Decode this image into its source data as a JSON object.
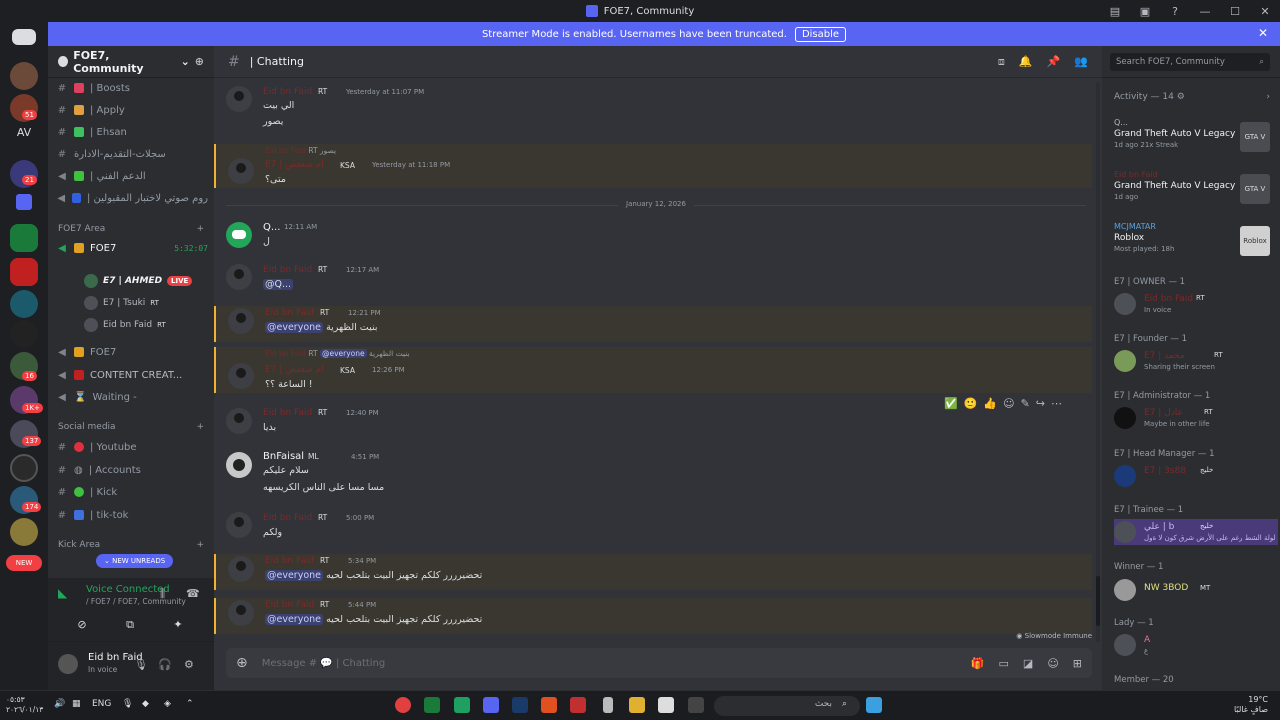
{
  "window": {
    "title": "FOE7, Community"
  },
  "banner": {
    "text": "Streamer Mode is enabled. Usernames have been truncated.",
    "button": "Disable"
  },
  "rail": {
    "av_label": "AV",
    "badges": [
      "51",
      "21",
      "16",
      "1K+",
      "137",
      "174"
    ],
    "new_label": "NEW"
  },
  "sidebar": {
    "guild_name": "FOE7, Community",
    "channels": [
      {
        "label": "| Boosts"
      },
      {
        "label": "| Apply"
      },
      {
        "label": "| Ehsan"
      },
      {
        "label": "سجلات-التقديم-الادارة"
      },
      {
        "label": "| الدعم الفني"
      },
      {
        "label": "| روم صوتي لاختبار المقبولين"
      }
    ],
    "cat_foe7": "FOE7 Area",
    "voice_foe7": "FOE7",
    "timer": "5:32:07",
    "voice_users": [
      {
        "name": "E7 | AHMED",
        "live": "LIVE"
      },
      {
        "name": "E7 | Tsuki",
        "tag": "RT"
      },
      {
        "name": "Eid bn Faid",
        "tag": "RT"
      }
    ],
    "voice2": "FOE7",
    "voice3": "CONTENT CREAT...",
    "voice4": "Waiting -",
    "cat_social": "Social media",
    "social": [
      {
        "label": "| Youtube"
      },
      {
        "label": "| Accounts"
      },
      {
        "label": "| Kick"
      },
      {
        "label": "| tik-tok"
      }
    ],
    "cat_kick": "Kick Area",
    "new_unreads": "NEW UNREADS",
    "voice_connected": "Voice Connected",
    "voice_sub": "/ FOE7 / FOE7, Community",
    "user_name": "Eid bn Faid",
    "user_status": "In voice"
  },
  "chat": {
    "channel": "| Chatting",
    "search_placeholder": "Search FOE7, Community",
    "date_divider": "January 12, 2026",
    "messages": [
      {
        "user": "Eid bn Faid",
        "tag": "RT",
        "time": "Yesterday at 11:07 PM",
        "lines": [
          "الي بيت",
          "يصور"
        ]
      },
      {
        "reply_user": "Eid bn Faid",
        "reply_tag": "RT",
        "reply_text": "يصور",
        "user": "E7 | ام صعقص",
        "tag": "KSA",
        "time": "Yesterday at 11:18 PM",
        "lines": [
          "متى؟"
        ]
      },
      {
        "user": "Q...",
        "time": "12:11 AM",
        "lines": [
          "ل"
        ]
      },
      {
        "user": "Eid bn Faid",
        "tag": "RT",
        "time": "12:17 AM",
        "lines": [
          "@Q..."
        ]
      },
      {
        "user": "Eid bn Faid",
        "tag": "RT",
        "time": "12:21 PM",
        "mention": "@everyone",
        "lines": [
          "بنيت الظهرية"
        ]
      },
      {
        "reply_user": "Eid bn Faid",
        "reply_tag": "RT",
        "reply_mention": "@everyone",
        "reply_text": "بنيت الظهرية",
        "user": "E7 | ام صعقص",
        "tag": "KSA",
        "time": "12:26 PM",
        "lines": [
          "الساعة ؟؟ !"
        ]
      },
      {
        "user": "Eid bn Faid",
        "tag": "RT",
        "time": "12:40 PM",
        "lines": [
          "بديا"
        ]
      },
      {
        "user": "BnFaisal",
        "tag": "ML",
        "time": "4:51 PM",
        "lines": [
          "سلام عليكم",
          "مسا مسا على الناس الكريسهه"
        ]
      },
      {
        "user": "Eid bn Faid",
        "tag": "RT",
        "time": "5:00 PM",
        "lines": [
          "ولكم"
        ]
      },
      {
        "user": "Eid bn Faid",
        "tag": "RT",
        "time": "5:34 PM",
        "mention": "@everyone",
        "lines": [
          "تحضيرررر كلكم تجهيز البيت بتلحب لحيه"
        ]
      },
      {
        "user": "Eid bn Faid",
        "tag": "RT",
        "time": "5:44 PM",
        "mention": "@everyone",
        "lines": [
          "تحضيرررر كلكم تجهيز البيت بتلحب لحيه"
        ]
      }
    ],
    "slowmode": "Slowmode Immune",
    "composer_placeholder": "Message #",
    "composer_channel": "| Chatting"
  },
  "members": {
    "activity_header": "Activity — 14",
    "activities": [
      {
        "user": "Q...",
        "game": "Grand Theft Auto V Legacy",
        "meta": "1d ago  21x Streak",
        "img": "GTA V"
      },
      {
        "user": "Eid bn Faid",
        "game": "Grand Theft Auto V Legacy",
        "meta": "1d ago",
        "img": "GTA V"
      },
      {
        "user": "MCJMATAR",
        "game": "Roblox",
        "meta": "Most played: 18h",
        "img": "Roblox"
      }
    ],
    "sections": [
      {
        "title": "E7 | OWNER — 1",
        "members": [
          {
            "name": "Eid bn Faid",
            "tag": "RT",
            "status": "In voice"
          }
        ]
      },
      {
        "title": "E7 | Founder — 1",
        "members": [
          {
            "name": "E7 | محمد",
            "tag": "RT",
            "status": "Sharing their screen"
          }
        ]
      },
      {
        "title": "E7 | Administrator — 1",
        "members": [
          {
            "name": "E7 | عادل",
            "tag": "RT",
            "status": "Maybe in other life"
          }
        ]
      },
      {
        "title": "E7 | Head Manager — 1",
        "members": [
          {
            "name": "E7 | 3s88",
            "tag": "خليج",
            "status": ""
          }
        ]
      },
      {
        "title": "E7 | Trainee — 1",
        "members": [
          {
            "name": "علي | b",
            "tag": "خليج",
            "status": "لولة الشط رغم على الأرض شرق كون لا ةول"
          }
        ]
      },
      {
        "title": "Winner — 1",
        "members": [
          {
            "name": "NW 3BOD",
            "tag": "MT",
            "status": ""
          }
        ]
      },
      {
        "title": "Lady — 1",
        "members": [
          {
            "name": "A",
            "tag": "",
            "status": "ع"
          }
        ]
      },
      {
        "title": "Member — 20",
        "members": []
      }
    ]
  },
  "taskbar": {
    "date1": "٠٥:٥٣",
    "date2": "٢٠٢٦/٠١/١٣",
    "lang": "ENG",
    "search": "بحث",
    "weather": "19°C",
    "weather2": "صافٍ غالبًا"
  },
  "colors": {
    "accent": "#5865f2",
    "highlight": "#f0b232",
    "online": "#23a55a",
    "live": "#ed4245"
  }
}
